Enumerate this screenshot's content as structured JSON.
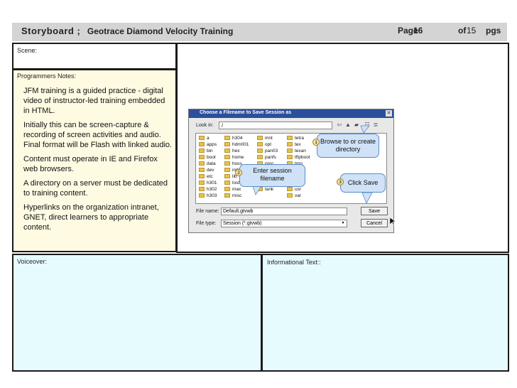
{
  "header": {
    "storyboard_label": "Storyboard ;",
    "course_title": "Geotrace Diamond Velocity Training",
    "page_label": "Page",
    "page_number": "16",
    "of_label": "of",
    "total_pages": "15",
    "pgs_label": "pgs"
  },
  "scene": {
    "label": "Scene:"
  },
  "programmers_notes": {
    "label": "Programmers Notes:",
    "paragraphs": [
      "JFM training is a guided practice - digital video of instructor-led training embedded in HTML.",
      "Initially this can be screen-capture & recording of screen activities and audio. Final format will be Flash with linked audio.",
      "Content must operate in IE and Firefox web browsers.",
      "A directory on a server must be dedicated to training content.",
      "Hyperlinks on the organization intranet, GNET, direct learners to appropriate content."
    ]
  },
  "voiceover": {
    "label": "Voiceover:"
  },
  "informational_text": {
    "label": "Informational Text::"
  },
  "dialog": {
    "title": "Choose a Filename to Save Session as",
    "look_in_label": "Look in:",
    "look_in_value": "/",
    "files": [
      "a",
      "apps",
      "bin",
      "boot",
      "data",
      "dev",
      "etc",
      "h301",
      "h302",
      "h303",
      "h304",
      "hdm001",
      "hex",
      "home",
      "hoss",
      "initrd",
      "lib",
      "lost+found",
      "max",
      "misc",
      "mnt",
      "opt",
      "pan03",
      "panfs",
      "proc",
      "root",
      "sbin",
      "scratch",
      "tank",
      "tetra",
      "tex",
      "texan",
      "tftpboot",
      "tmp",
      "usr",
      "var"
    ],
    "file_name_label": "File name:",
    "file_name_value": "Default.gtvwb",
    "file_type_label": "File type:",
    "file_type_value": "Session (*.gtvwb)",
    "save_button": "Save",
    "cancel_button": "Cancel"
  },
  "callouts": [
    {
      "number": "1",
      "text": "Browse to or create directory"
    },
    {
      "number": "2",
      "text": "Enter session filename"
    },
    {
      "number": "3",
      "text": "Click Save"
    }
  ]
}
